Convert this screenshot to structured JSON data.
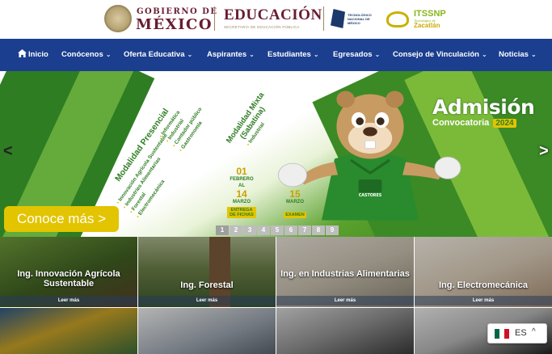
{
  "header": {
    "gob_line1": "GOBIERNO DE",
    "gob_line2": "MÉXICO",
    "edu_title": "EDUCACIÓN",
    "edu_subtitle": "SECRETARÍA DE EDUCACIÓN PÚBLICA",
    "tecnm_text": "TECNOLÓGICO NACIONAL DE MÉXICO",
    "itssnp_title": "ITSSNP",
    "itssnp_sub": "Tecnológico de",
    "itssnp_place": "Zacatlán"
  },
  "nav": {
    "items": [
      {
        "label": "Inicio"
      },
      {
        "label": "Conócenos"
      },
      {
        "label": "Oferta Educativa"
      },
      {
        "label": "Aspirantes"
      },
      {
        "label": "Estudiantes"
      },
      {
        "label": "Egresados"
      },
      {
        "label": "Consejo de Vinculación"
      },
      {
        "label": "Noticias"
      }
    ],
    "chevron": "⌄"
  },
  "hero": {
    "modalidad_presencial": "Modalidad Presencial",
    "presencial_col1": [
      "Innovación Agrícola Sustentable",
      "Industrias Alimentarias",
      "Forestal",
      "Electromecánica"
    ],
    "presencial_col2": [
      "Informática",
      "Industrial",
      "Contador público",
      "Gastronomía"
    ],
    "modalidad_mixta": "Modalidad Mixta",
    "sabatina": "(Sabatina)",
    "mixta_list": [
      "Industrial"
    ],
    "date1_day1": "01",
    "date1_month1": "FEBRERO",
    "date1_al": "AL",
    "date1_day2": "14",
    "date1_month2": "MARZO",
    "date1_tag": "ENTREGA DE FICHAS",
    "date2_day": "15",
    "date2_month": "MARZO",
    "date2_tag": "EXAMEN",
    "admision": "Admisión",
    "convocatoria": "Convocatoria",
    "year": "2024",
    "cta": "Conoce más >",
    "prev": "<",
    "next": ">",
    "pages": [
      "1",
      "2",
      "3",
      "4",
      "5",
      "6",
      "7",
      "8",
      "9"
    ],
    "active_page": "1",
    "mascot_shirt": "CASTORES"
  },
  "programs": [
    {
      "title": "Ing. Innovación Agrícola Sustentable",
      "more": "Leer más"
    },
    {
      "title": "Ing. Forestal",
      "more": "Leer más"
    },
    {
      "title": "Ing. en Industrias Alimentarias",
      "more": "Leer más"
    },
    {
      "title": "Ing. Electromecánica",
      "more": "Leer más"
    }
  ],
  "language": {
    "code": "ES",
    "chevron": "^"
  },
  "colors": {
    "nav_bg": "#1b3e8f",
    "brand_wine": "#691c32",
    "green_dark": "#2e7d22",
    "accent_yellow": "#e3c400"
  }
}
